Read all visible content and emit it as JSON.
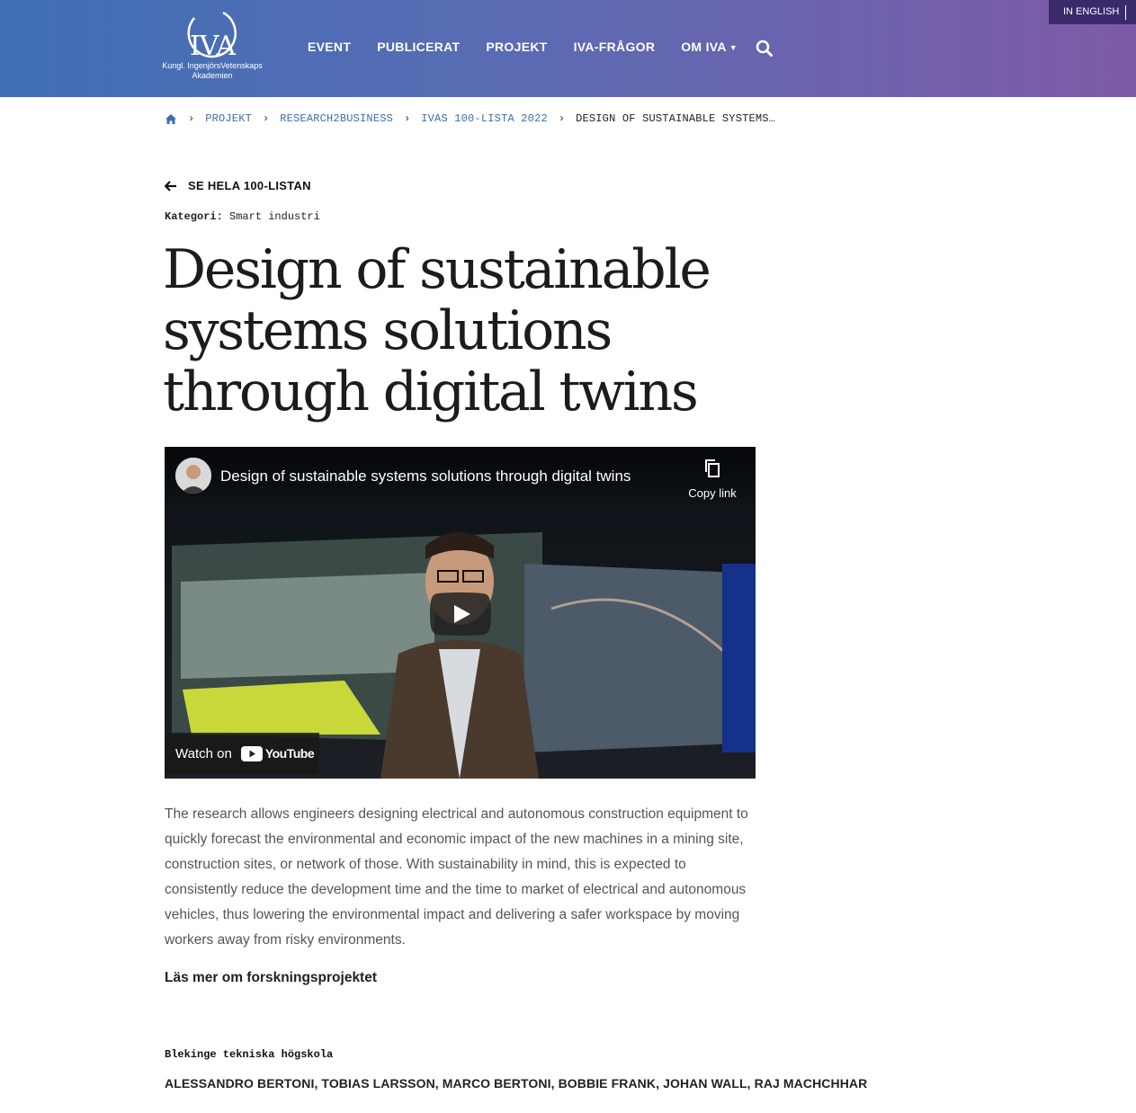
{
  "header": {
    "logo_text": "IVA",
    "logo_line1": "Kungl. IngenjörsVetenskaps",
    "logo_line2": "Akademien",
    "nav": [
      "EVENT",
      "PUBLICERAT",
      "PROJEKT",
      "IVA-FRÅGOR",
      "OM IVA"
    ],
    "lang_label": "IN ENGLISH"
  },
  "breadcrumb": {
    "items": [
      "PROJEKT",
      "RESEARCH2BUSINESS",
      "IVAS 100-LISTA 2022"
    ],
    "current": "DESIGN OF SUSTAINABLE SYSTEMS…"
  },
  "back_link": "SE HELA 100-LISTAN",
  "category": {
    "label": "Kategori:",
    "value": "Smart industri"
  },
  "title": "Design of sustainable systems solutions through digital twins",
  "video": {
    "title": "Design of sustainable systems solutions through digital twins",
    "copy_label": "Copy link",
    "watch_on": "Watch on",
    "youtube": "YouTube"
  },
  "body": "The research allows engineers designing electrical and autonomous construction equipment to quickly forecast the environmental and economic impact of the new machines in a mining site, construction sites, or network of those. With sustainability in mind, this is expected to consistently reduce the development time and the time to market of electrical and autonomous vehicles, thus lowering the environmental impact and delivering a safer workspace by moving workers away from risky environments.",
  "read_more": "Läs mer om forskningsprojektet",
  "organization": "Blekinge tekniska högskola",
  "authors": "ALESSANDRO BERTONI, TOBIAS LARSSON, MARCO BERTONI, BOBBIE FRANK, JOHAN WALL, RAJ MACHCHHAR",
  "colors": {
    "header_start": "#3f6fb5",
    "header_end": "#7e5aa6",
    "lang_bg": "#3b2a6b",
    "link": "#3a6fb0"
  },
  "icons": [
    "home-icon",
    "search-icon",
    "arrow-left-icon",
    "chevron-down-icon",
    "copy-icon",
    "play-icon",
    "youtube-logo"
  ]
}
